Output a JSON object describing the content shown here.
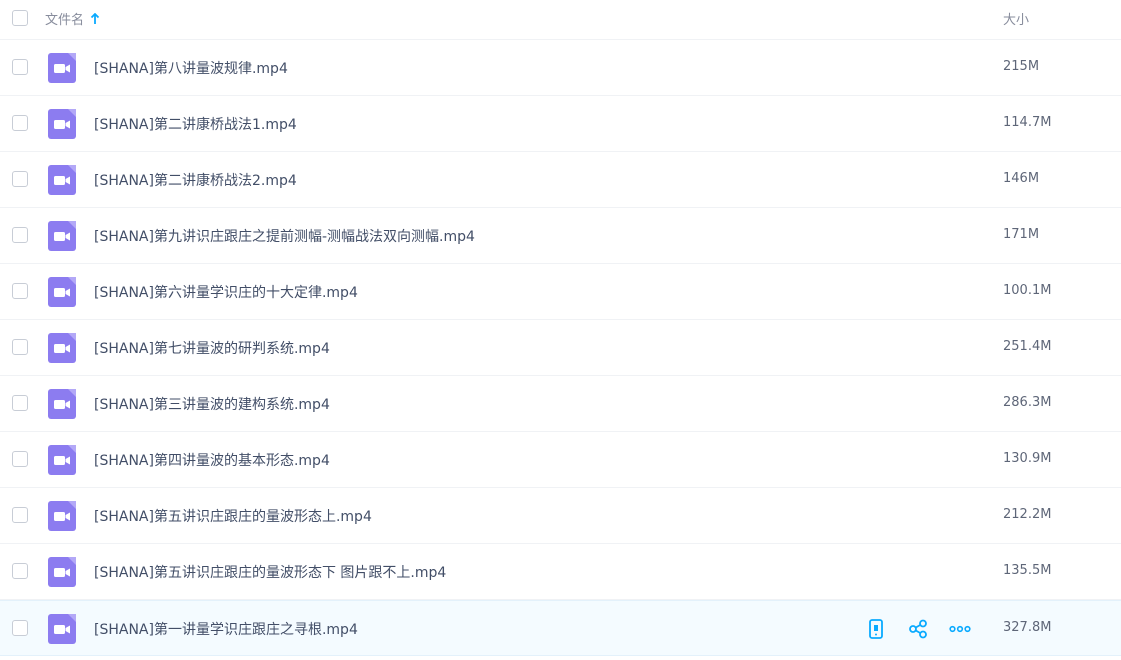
{
  "header": {
    "name_label": "文件名",
    "size_label": "大小",
    "sort_direction": "ascending"
  },
  "files": [
    {
      "name": "[SHANA]第八讲量波规律.mp4",
      "size": "215M"
    },
    {
      "name": "[SHANA]第二讲康桥战法1.mp4",
      "size": "114.7M"
    },
    {
      "name": "[SHANA]第二讲康桥战法2.mp4",
      "size": "146M"
    },
    {
      "name": "[SHANA]第九讲识庄跟庄之提前测幅-测幅战法双向测幅.mp4",
      "size": "171M"
    },
    {
      "name": "[SHANA]第六讲量学识庄的十大定律.mp4",
      "size": "100.1M"
    },
    {
      "name": "[SHANA]第七讲量波的研判系统.mp4",
      "size": "251.4M"
    },
    {
      "name": "[SHANA]第三讲量波的建构系统.mp4",
      "size": "286.3M"
    },
    {
      "name": "[SHANA]第四讲量波的基本形态.mp4",
      "size": "130.9M"
    },
    {
      "name": "[SHANA]第五讲识庄跟庄的量波形态上.mp4",
      "size": "212.2M"
    },
    {
      "name": "[SHANA]第五讲识庄跟庄的量波形态下 图片跟不上.mp4",
      "size": "135.5M"
    },
    {
      "name": "[SHANA]第一讲量学识庄跟庄之寻根.mp4",
      "size": "327.8M",
      "hovered": true
    }
  ],
  "icons": {
    "file_type": "video-file-icon",
    "actions": [
      "phone-icon",
      "share-icon",
      "more-icon"
    ]
  },
  "colors": {
    "file_icon": "#8c7cf0",
    "accent": "#09aaff",
    "hover_row": "#f4fbff"
  }
}
